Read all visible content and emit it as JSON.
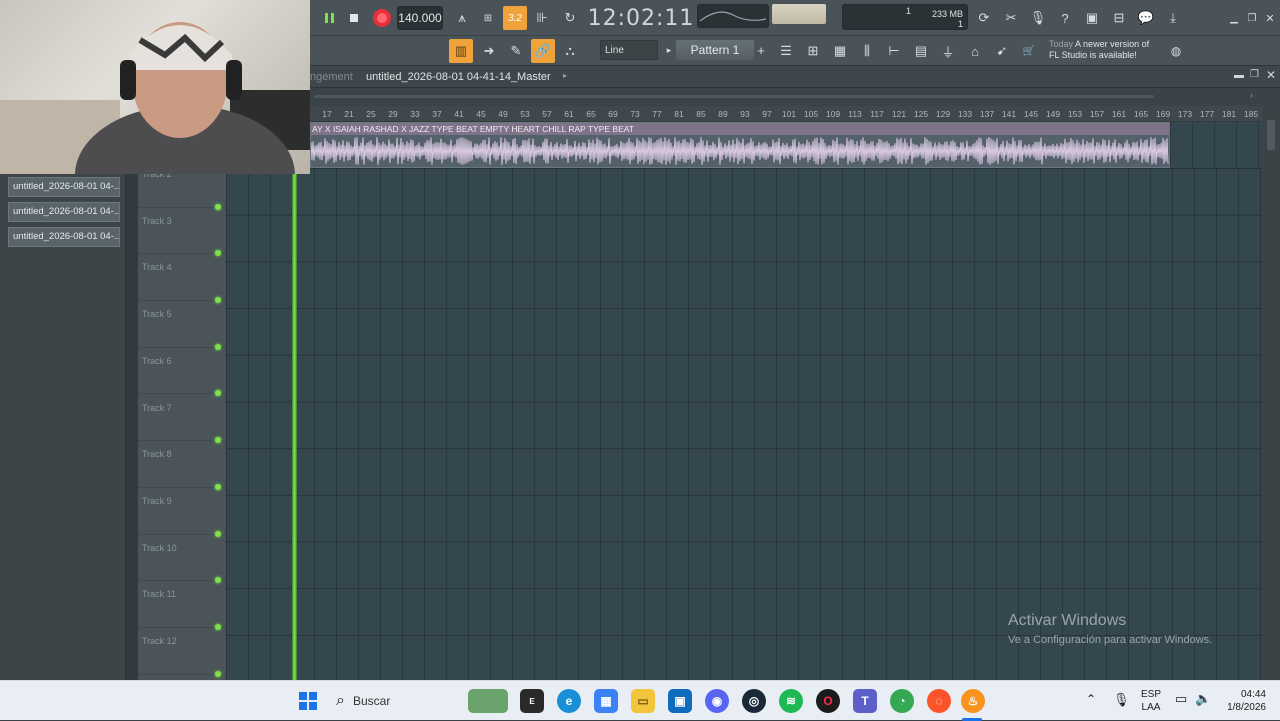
{
  "toolbar": {
    "tempo": "140.000",
    "time": "12:02:11",
    "time_sub": "B:S:T",
    "cpu_memory": "233 MB",
    "cpu_value1": "1",
    "cpu_value2": "1",
    "snap_mode": "Line",
    "pattern_name": "Pattern 1",
    "hint_day": "Today",
    "hint_text_line1": "A newer version of",
    "hint_text_line2": "FL Studio is available!",
    "step_indicator": "3.2"
  },
  "playlist": {
    "title_prefix": "ngement",
    "title": "untitled_2026-08-01 04-41-14_Master",
    "ruler_marks": [
      "17",
      "21",
      "25",
      "29",
      "33",
      "37",
      "41",
      "45",
      "49",
      "53",
      "57",
      "61",
      "65",
      "69",
      "73",
      "77",
      "81",
      "85",
      "89",
      "93",
      "97",
      "101",
      "105",
      "109",
      "113",
      "117",
      "121",
      "125",
      "129",
      "133",
      "137",
      "141",
      "145",
      "149",
      "153",
      "157",
      "161",
      "165",
      "169",
      "173",
      "177",
      "181",
      "185"
    ],
    "clip_name": "AY X ISAIAH RASHAD X JAZZ TYPE BEAT EMPTY HEART  CHILL RAP TYPE BEAT",
    "tracks": [
      {
        "label": "Track 2"
      },
      {
        "label": "Track 3"
      },
      {
        "label": "Track 4"
      },
      {
        "label": "Track 5"
      },
      {
        "label": "Track 6"
      },
      {
        "label": "Track 7"
      },
      {
        "label": "Track 8"
      },
      {
        "label": "Track 9"
      },
      {
        "label": "Track 10"
      },
      {
        "label": "Track 11"
      },
      {
        "label": "Track 12"
      }
    ]
  },
  "browser": {
    "items": [
      {
        "label": "untitled_2026-08-01 04-..."
      },
      {
        "label": "untitled_2026-08-01 04-..."
      },
      {
        "label": "untitled_2026-08-01 04-..."
      }
    ]
  },
  "watermark": {
    "line1": "Activar Windows",
    "line2": "Ve a Configuración para activar Windows."
  },
  "taskbar": {
    "search_placeholder": "Buscar",
    "lang_line1": "ESP",
    "lang_line2": "LAA",
    "clock_time": "04:44",
    "clock_date": "1/8/2026",
    "app_icons": [
      "windows-start",
      "news-widget",
      "epic-games",
      "edge",
      "microsoft-store",
      "file-explorer",
      "outlook",
      "discord",
      "steam",
      "spotify",
      "opera-gx",
      "teams",
      "chrome",
      "brave",
      "fl-studio"
    ]
  },
  "colors": {
    "accent_green": "#7fe24a",
    "record_red": "#e8303b",
    "clip_header": "#7f7389",
    "step_orange": "#f0a33a"
  }
}
